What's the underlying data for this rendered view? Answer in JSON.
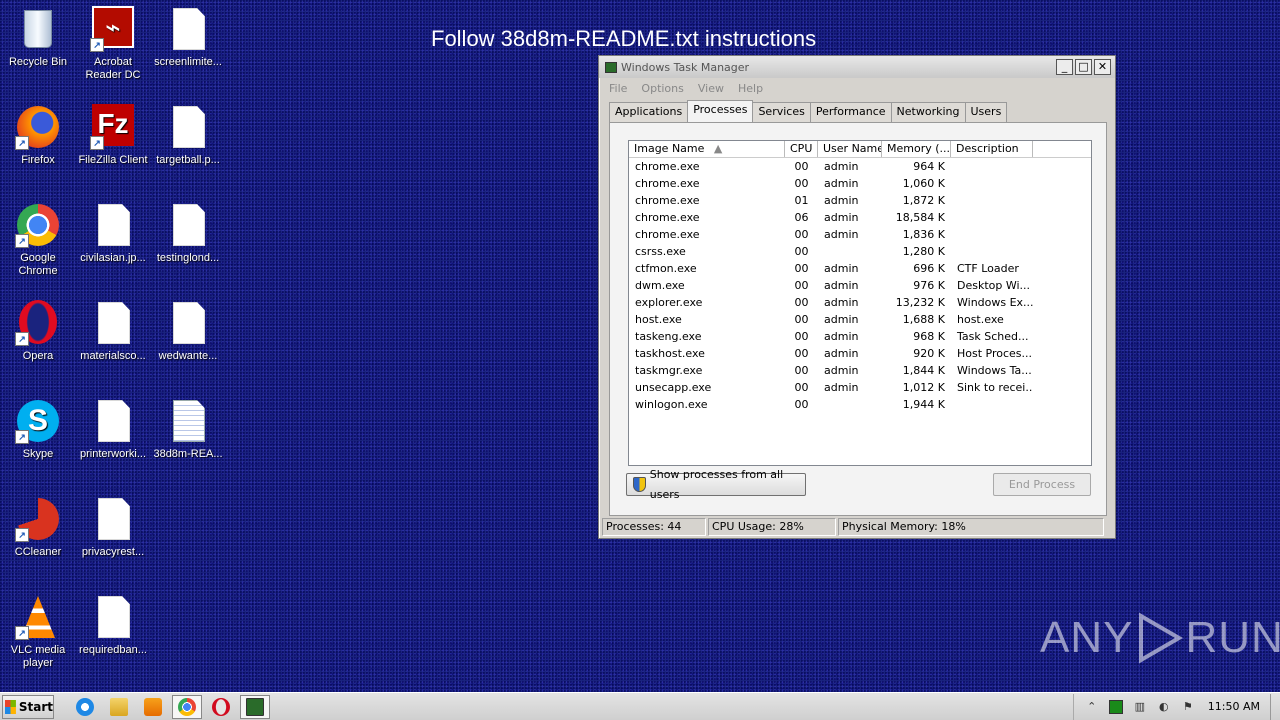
{
  "banner": "Follow 38d8m-README.txt instructions",
  "watermark": {
    "left": "ANY",
    "right": "RUN"
  },
  "desktop_icons": [
    {
      "label": "Recycle Bin",
      "kind": "recycle"
    },
    {
      "label": "Acrobat Reader DC",
      "kind": "acrobat"
    },
    {
      "label": "screenlimite...",
      "kind": "file"
    },
    {
      "label": "Firefox",
      "kind": "firefox"
    },
    {
      "label": "FileZilla Client",
      "kind": "filezilla"
    },
    {
      "label": "targetball.p...",
      "kind": "file"
    },
    {
      "label": "Google Chrome",
      "kind": "chrome"
    },
    {
      "label": "civilasian.jp...",
      "kind": "file"
    },
    {
      "label": "testinglond...",
      "kind": "file"
    },
    {
      "label": "Opera",
      "kind": "opera"
    },
    {
      "label": "materialsco...",
      "kind": "file"
    },
    {
      "label": "wedwante...",
      "kind": "file"
    },
    {
      "label": "Skype",
      "kind": "skype"
    },
    {
      "label": "printerworki...",
      "kind": "file"
    },
    {
      "label": "38d8m-REA...",
      "kind": "txt"
    },
    {
      "label": "CCleaner",
      "kind": "ccleaner"
    },
    {
      "label": "privacyrest...",
      "kind": "file"
    },
    {
      "label": "VLC media player",
      "kind": "vlc"
    },
    {
      "label": "requiredban...",
      "kind": "file"
    }
  ],
  "task_manager": {
    "title": "Windows Task Manager",
    "menu": [
      "File",
      "Options",
      "View",
      "Help"
    ],
    "tabs": [
      "Applications",
      "Processes",
      "Services",
      "Performance",
      "Networking",
      "Users"
    ],
    "active_tab": "Processes",
    "columns": [
      "Image Name",
      "CPU",
      "User Name",
      "Memory (...",
      "Description"
    ],
    "processes": [
      {
        "name": "chrome.exe",
        "cpu": "00",
        "user": "admin",
        "mem": "964 K",
        "desc": ""
      },
      {
        "name": "chrome.exe",
        "cpu": "00",
        "user": "admin",
        "mem": "1,060 K",
        "desc": ""
      },
      {
        "name": "chrome.exe",
        "cpu": "01",
        "user": "admin",
        "mem": "1,872 K",
        "desc": ""
      },
      {
        "name": "chrome.exe",
        "cpu": "06",
        "user": "admin",
        "mem": "18,584 K",
        "desc": ""
      },
      {
        "name": "chrome.exe",
        "cpu": "00",
        "user": "admin",
        "mem": "1,836 K",
        "desc": ""
      },
      {
        "name": "csrss.exe",
        "cpu": "00",
        "user": "",
        "mem": "1,280 K",
        "desc": ""
      },
      {
        "name": "ctfmon.exe",
        "cpu": "00",
        "user": "admin",
        "mem": "696 K",
        "desc": "CTF Loader"
      },
      {
        "name": "dwm.exe",
        "cpu": "00",
        "user": "admin",
        "mem": "976 K",
        "desc": "Desktop Wi..."
      },
      {
        "name": "explorer.exe",
        "cpu": "00",
        "user": "admin",
        "mem": "13,232 K",
        "desc": "Windows Ex..."
      },
      {
        "name": "host.exe",
        "cpu": "00",
        "user": "admin",
        "mem": "1,688 K",
        "desc": "host.exe"
      },
      {
        "name": "taskeng.exe",
        "cpu": "00",
        "user": "admin",
        "mem": "968 K",
        "desc": "Task Sched..."
      },
      {
        "name": "taskhost.exe",
        "cpu": "00",
        "user": "admin",
        "mem": "920 K",
        "desc": "Host Proces..."
      },
      {
        "name": "taskmgr.exe",
        "cpu": "00",
        "user": "admin",
        "mem": "1,844 K",
        "desc": "Windows Ta..."
      },
      {
        "name": "unsecapp.exe",
        "cpu": "00",
        "user": "admin",
        "mem": "1,012 K",
        "desc": "Sink to recei..."
      },
      {
        "name": "winlogon.exe",
        "cpu": "00",
        "user": "",
        "mem": "1,944 K",
        "desc": ""
      }
    ],
    "show_all_label": "Show processes from all users",
    "end_process_label": "End Process",
    "status": {
      "processes": "Processes: 44",
      "cpu": "CPU Usage: 28%",
      "memory": "Physical Memory: 18%"
    }
  },
  "taskbar": {
    "start_label": "Start",
    "pinned": [
      "ie-icon",
      "explorer-icon",
      "media-player-icon",
      "chrome-icon",
      "opera-icon",
      "task-manager-icon"
    ],
    "clock": "11:50 AM"
  }
}
